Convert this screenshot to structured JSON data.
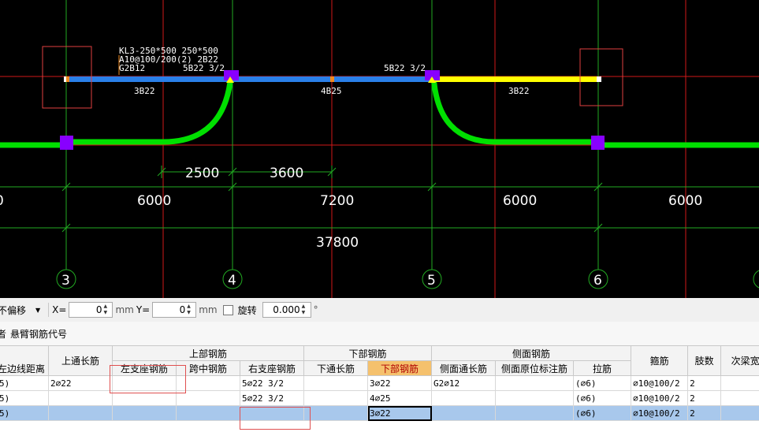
{
  "cad": {
    "beam_label_lines": [
      "KL3-250*500 250*500",
      "A10@100/200(2) 2B22",
      "G2B12"
    ],
    "top_rebar_left": "5B22 3/2",
    "top_rebar_right": "5B22 3/2",
    "bottom_rebar_labels": [
      "3B22",
      "4B25",
      "3B22"
    ],
    "dims_small": [
      "2500",
      "3600"
    ],
    "dims_spans": [
      "0",
      "6000",
      "7200",
      "6000",
      "6000"
    ],
    "dim_total": "37800",
    "axis_labels": [
      "3",
      "4",
      "5",
      "6"
    ],
    "colors": {
      "beam_blue": "#2a7fe8",
      "beam_yellow": "#ffff00",
      "rebar_green": "#00e000",
      "support_purple": "#8800ff",
      "grid_red": "#d01818",
      "grid_green": "#22aa22"
    }
  },
  "toolbar": {
    "offset_mode": "不偏移",
    "x_label": "X=",
    "x_value": "0",
    "x_unit": "mm",
    "y_label": "Y=",
    "y_value": "0",
    "y_unit": "mm",
    "rotate_label": "旋转",
    "rotate_value": "0.000",
    "rotate_unit": "°"
  },
  "tabs": {
    "left_fragment": "者",
    "cantilever": "悬臂钢筋代号"
  },
  "table": {
    "group_headers": {
      "top_through": "上通长筋",
      "top_rebar": "上部钢筋",
      "bottom_rebar": "下部钢筋",
      "side_rebar": "侧面钢筋",
      "stirrup": "箍筋",
      "legs": "肢数",
      "secondary_width": "次梁宽"
    },
    "sub_headers": {
      "edge_distance": "左边线距离",
      "left_support": "左支座钢筋",
      "mid_span": "跨中钢筋",
      "right_support": "右支座钢筋",
      "bottom_through": "下通长筋",
      "bottom_bars": "下部钢筋",
      "side_through": "侧面通长筋",
      "side_original": "侧面原位标注筋",
      "tie_bars": "拉筋"
    },
    "rows": [
      {
        "edge": "5)",
        "top_through": "2⌀22",
        "left_support": "",
        "mid_span": "",
        "right_support": "5⌀22 3/2",
        "bottom_through": "",
        "bottom_bars": "3⌀22",
        "side_through": "G2⌀12",
        "side_original": "",
        "tie": "(⌀6)",
        "stirrup": "⌀10@100/2",
        "legs": "2",
        "secondary": ""
      },
      {
        "edge": "5)",
        "top_through": "",
        "left_support": "",
        "mid_span": "",
        "right_support": "5⌀22 3/2",
        "bottom_through": "",
        "bottom_bars": "4⌀25",
        "side_through": "",
        "side_original": "",
        "tie": "(⌀6)",
        "stirrup": "⌀10@100/2",
        "legs": "2",
        "secondary": ""
      },
      {
        "edge": "5)",
        "top_through": "",
        "left_support": "",
        "mid_span": "",
        "right_support": "",
        "bottom_through": "",
        "bottom_bars": "3⌀22",
        "side_through": "",
        "side_original": "",
        "tie": "(⌀6)",
        "stirrup": "⌀10@100/2",
        "legs": "2",
        "secondary": ""
      }
    ]
  }
}
